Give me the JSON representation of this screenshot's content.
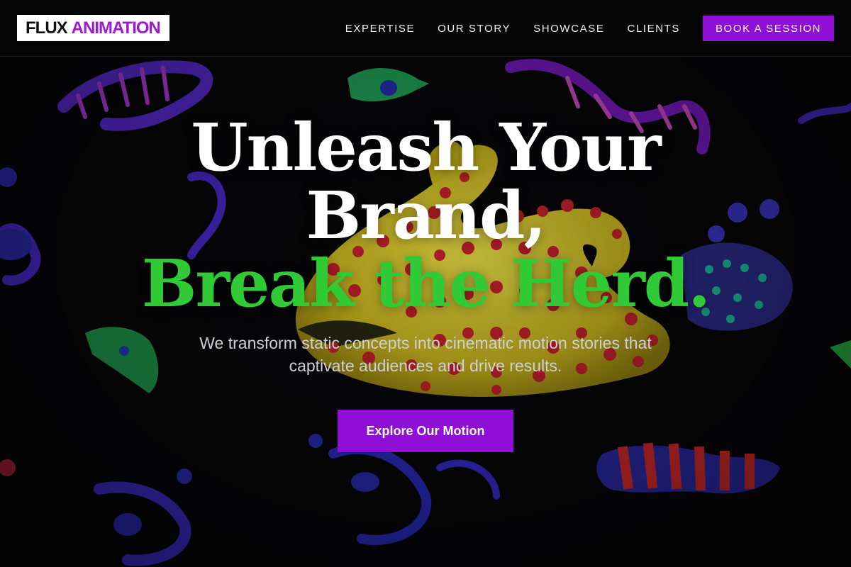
{
  "brand": {
    "logo_part1": "FLUX",
    "logo_part2": "ANIMATION",
    "accent_color": "#9b18d4",
    "headline_accent_color": "#2fca36"
  },
  "nav": {
    "items": [
      {
        "label": "EXPERTISE"
      },
      {
        "label": "OUR STORY"
      },
      {
        "label": "SHOWCASE"
      },
      {
        "label": "CLIENTS"
      }
    ],
    "cta_label": "BOOK A SESSION"
  },
  "hero": {
    "headline_line1": "Unleash Your",
    "headline_line2": "Brand,",
    "headline_line3": "Break the Herd.",
    "subtitle": "We transform static concepts into cinematic motion stories that captivate audiences and drive results.",
    "cta_label": "Explore Our Motion"
  }
}
